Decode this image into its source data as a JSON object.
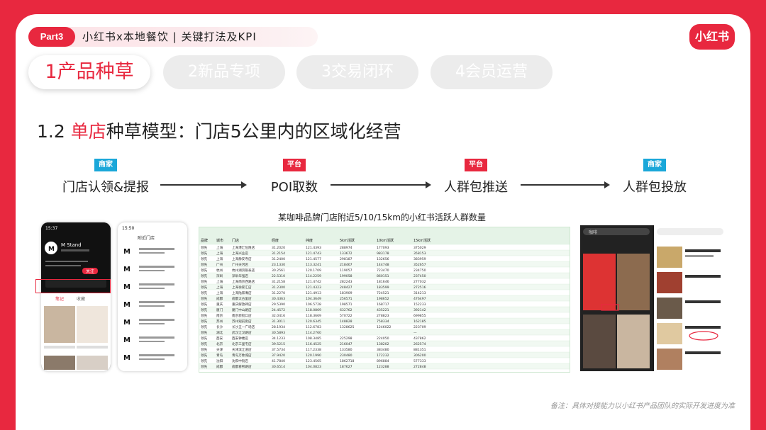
{
  "header": {
    "part_badge": "Part3",
    "title": "小红书x本地餐饮 | 关键打法及KPI",
    "logo": "小红书"
  },
  "tabs": [
    {
      "label": "1产品种草",
      "active": true
    },
    {
      "label": "2新品专项",
      "active": false
    },
    {
      "label": "3交易闭环",
      "active": false
    },
    {
      "label": "4会员运营",
      "active": false
    }
  ],
  "section_title": {
    "prefix": "1.2 ",
    "highlight": "单店",
    "suffix": "种草模型：门店5公里内的区域化经营"
  },
  "flow": [
    {
      "tag": "商家",
      "tag_color": "#1aa7d9",
      "label": "门店认领&提报"
    },
    {
      "tag": "平台",
      "tag_color": "#e8283f",
      "label": "POI取数"
    },
    {
      "tag": "平台",
      "tag_color": "#e8283f",
      "label": "人群包推送"
    },
    {
      "tag": "商家",
      "tag_color": "#1aa7d9",
      "label": "人群包投放"
    }
  ],
  "table_caption": "某咖啡品牌门店附近5/10/15km的小红书活跃人群数量",
  "phone_left": {
    "time": "15:37",
    "account": "M Stand",
    "button": "关注",
    "tabs": [
      "笔记",
      "收藏"
    ]
  },
  "phone_right": {
    "time": "15:50",
    "title": "附近门店",
    "store_prefix": "M Stand"
  },
  "table": {
    "headers": [
      "品牌",
      "城市",
      "门店",
      "经度",
      "纬度",
      "5km活跃",
      "10km活跃",
      "15km活跃"
    ],
    "rows": [
      [
        "领先",
        "上海",
        "上海港汇恒隆店",
        "31.2020",
        "121.4393",
        "288974",
        "177093",
        "375029"
      ],
      [
        "领先",
        "上海",
        "上海兴业店",
        "31.2154",
        "121.4743",
        "133672",
        "983178",
        "358153"
      ],
      [
        "领先",
        "上海",
        "上海静安寺店",
        "31.2400",
        "121.4577",
        "298187",
        "132656",
        "383959"
      ],
      [
        "领先",
        "广州",
        "广州天河店",
        "23.1330",
        "113.3241",
        "218467",
        "144748",
        "352657"
      ],
      [
        "领先",
        "杭州",
        "杭州湖滨银泰店",
        "30.2561",
        "120.1709",
        "119057",
        "723470",
        "234750"
      ],
      [
        "领先",
        "深圳",
        "深圳华强店",
        "22.5310",
        "114.2259",
        "199058",
        "860151",
        "237450"
      ],
      [
        "领先",
        "上海",
        "上海南京西路店",
        "31.2158",
        "121.4742",
        "282243",
        "181646",
        "277032"
      ],
      [
        "领先",
        "上海",
        "上海徐家汇店",
        "31.2300",
        "121.4323",
        "248427",
        "183599",
        "272516"
      ],
      [
        "领先",
        "上海",
        "上海陆家嘴店",
        "31.2270",
        "121.4913",
        "183909",
        "724521",
        "314213"
      ],
      [
        "领先",
        "成都",
        "成都太古里店",
        "30.4363",
        "104.3649",
        "256571",
        "198652",
        "476497"
      ],
      [
        "领先",
        "重庆",
        "重庆解放碑店",
        "29.5390",
        "106.5728",
        "198571",
        "168717",
        "152233"
      ],
      [
        "领先",
        "厦门",
        "厦门中山路店",
        "24.4572",
        "118.0869",
        "632762",
        "435221",
        "392142"
      ],
      [
        "领先",
        "南京",
        "南京新街口店",
        "32.0416",
        "118.3669",
        "570722",
        "278823",
        "699855"
      ],
      [
        "领先",
        "苏州",
        "苏州观前街店",
        "31.3011",
        "120.6345",
        "148828",
        "758334",
        "162185"
      ],
      [
        "领先",
        "长沙",
        "长沙五一广场店",
        "28.1934",
        "112.6783",
        "1328625",
        "1246022",
        "223709"
      ],
      [
        "领先",
        "湖北",
        "武汉江汉路店",
        "30.5893",
        "114.2760",
        "",
        "",
        "—"
      ],
      [
        "领先",
        "西安",
        "西安钟楼店",
        "34.1233",
        "108.3485",
        "225298",
        "224050",
        "437862"
      ],
      [
        "领先",
        "北京",
        "北京三里屯店",
        "39.5215",
        "116.4525",
        "216047",
        "138202",
        "262574"
      ],
      [
        "领先",
        "天津",
        "天津滨江道店",
        "37.5734",
        "117.2338",
        "133580",
        "383480",
        "881351"
      ],
      [
        "领先",
        "青岛",
        "青岛万象城店",
        "37.9420",
        "120.1990",
        "230480",
        "172232",
        "306200"
      ],
      [
        "领先",
        "沈阳",
        "沈阳中街店",
        "41.7840",
        "123.4565",
        "1862718",
        "896884",
        "577333"
      ],
      [
        "领先",
        "成都",
        "成都春熙路店",
        "30.6514",
        "104.0823",
        "187627",
        "123288",
        "272848"
      ]
    ]
  },
  "app_shots": {
    "search_query": "咖啡"
  },
  "note": "备注：具体对接能力以小红书产品团队的实际开发进度为准"
}
